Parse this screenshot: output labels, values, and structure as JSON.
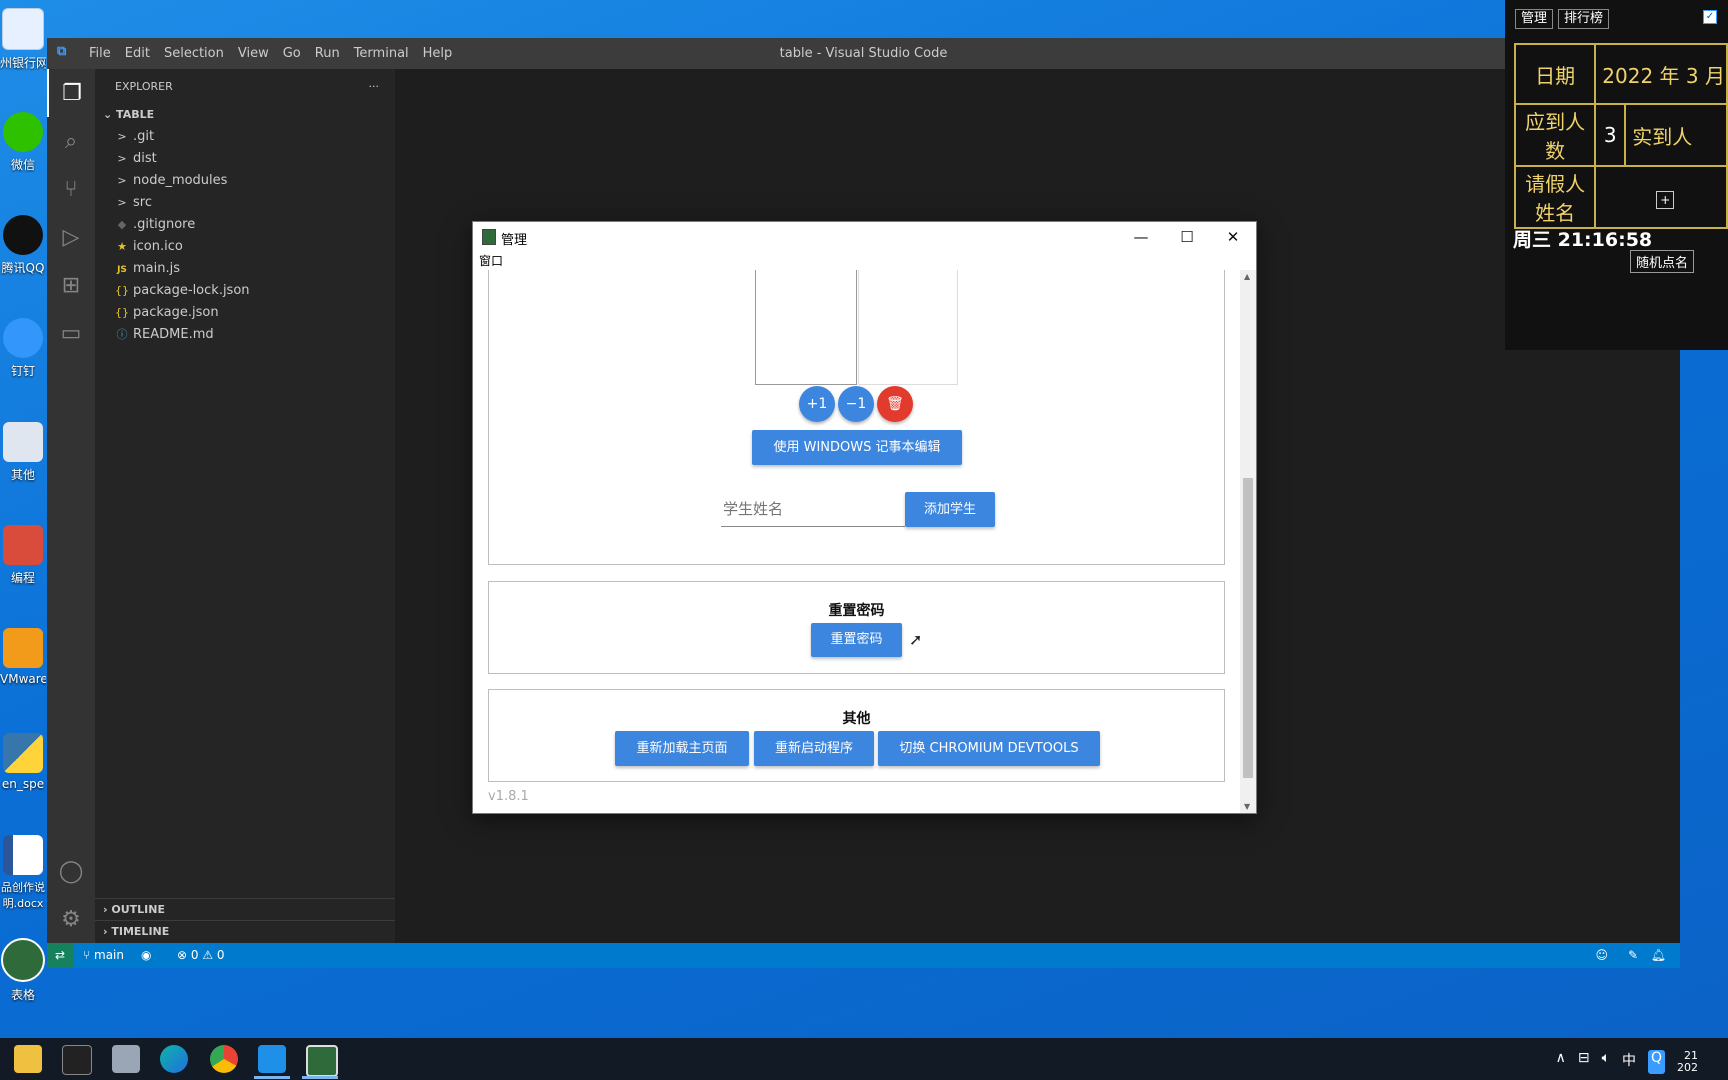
{
  "desktop": {
    "icons": [
      {
        "label": "州银行网"
      },
      {
        "label": "微信"
      },
      {
        "label": "腾讯QQ"
      },
      {
        "label": "钉钉"
      },
      {
        "label": "其他"
      },
      {
        "label": "编程"
      },
      {
        "label": "VMware Workstati"
      },
      {
        "label": "en_spe"
      },
      {
        "label": "品创作说明.docx"
      },
      {
        "label": "表格"
      }
    ]
  },
  "vscode": {
    "menu": [
      "File",
      "Edit",
      "Selection",
      "View",
      "Go",
      "Run",
      "Terminal",
      "Help"
    ],
    "window_title": "table - Visual Studio Code",
    "explorer_label": "EXPLORER",
    "explorer_more": "···",
    "root_folder": "TABLE",
    "files": [
      {
        "name": ".git",
        "icon": ">"
      },
      {
        "name": "dist",
        "icon": ">"
      },
      {
        "name": "node_modules",
        "icon": ">"
      },
      {
        "name": "src",
        "icon": ">"
      },
      {
        "name": ".gitignore",
        "icon": "◆"
      },
      {
        "name": "icon.ico",
        "icon": "★"
      },
      {
        "name": "main.js",
        "icon": "JS"
      },
      {
        "name": "package-lock.json",
        "icon": "{}"
      },
      {
        "name": "package.json",
        "icon": "{}"
      },
      {
        "name": "README.md",
        "icon": "ⓘ"
      }
    ],
    "outline": "OUTLINE",
    "timeline": "TIMELINE",
    "status": {
      "branch": "main",
      "errors": "⊗ 0",
      "warnings": "⚠ 0"
    }
  },
  "manager": {
    "title": "管理",
    "menu": "窗口",
    "plus_one": "+1",
    "minus_one": "−1",
    "notepad_button": "使用 WINDOWS 记事本编辑",
    "student_placeholder": "学生姓名",
    "add_student_button": "添加学生",
    "reset_section_title": "重置密码",
    "reset_button": "重置密码",
    "other_section_title": "其他",
    "reload_button": "重新加载主页面",
    "restart_button": "重新启动程序",
    "devtools_button": "切换 CHROMIUM DEVTOOLS",
    "version": "v1.8.1"
  },
  "attendance": {
    "manage_btn": "管理",
    "rank_btn": "排行榜",
    "date_label": "日期",
    "date_value": "2022 年 3 月",
    "expected_label": "应到人数",
    "expected_value": "3",
    "actual_label": "实到人",
    "leave_label": "请假人姓名",
    "add": "+",
    "clock": "周三 21:16:58",
    "random_btn": "随机点名"
  },
  "tray": {
    "ime": "中",
    "time": "21",
    "date": "202"
  }
}
